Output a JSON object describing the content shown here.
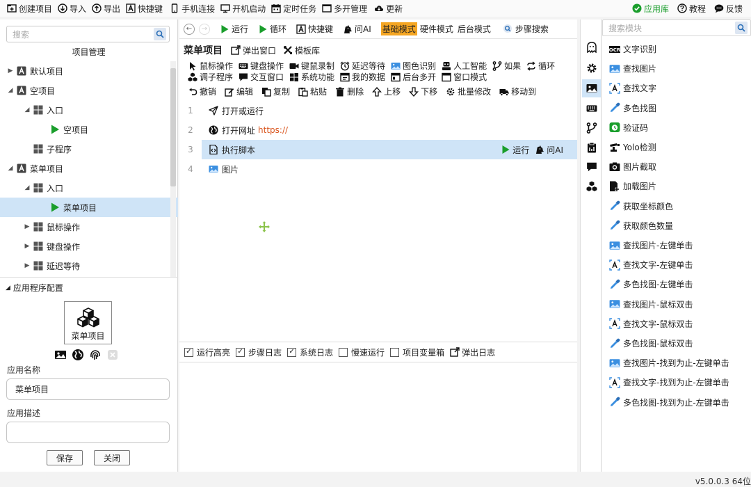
{
  "topbar": {
    "left": [
      {
        "label": "创建项目",
        "icon": "new-project-icon"
      },
      {
        "label": "导入",
        "icon": "import-icon"
      },
      {
        "label": "导出",
        "icon": "export-icon"
      },
      {
        "label": "快捷键",
        "icon": "hotkey-icon"
      },
      {
        "label": "手机连接",
        "icon": "phone-icon"
      },
      {
        "label": "开机启动",
        "icon": "boot-icon"
      },
      {
        "label": "定时任务",
        "icon": "calendar-icon"
      },
      {
        "label": "多开管理",
        "icon": "window-icon"
      },
      {
        "label": "更新",
        "icon": "cloud-icon"
      }
    ],
    "right": [
      {
        "label": "应用库",
        "icon": "check-circle-icon"
      },
      {
        "label": "教程",
        "icon": "help-icon"
      },
      {
        "label": "反馈",
        "icon": "chat-icon"
      }
    ]
  },
  "left": {
    "search_placeholder": "搜索",
    "title": "项目管理",
    "tree": [
      {
        "label": "默认项目",
        "level": 0,
        "arrow": "▶",
        "icon": "project"
      },
      {
        "label": "空项目",
        "level": 0,
        "arrow": "◢",
        "icon": "project"
      },
      {
        "label": "入口",
        "level": 1,
        "arrow": "◢",
        "icon": "grid"
      },
      {
        "label": "空项目",
        "level": 2,
        "arrow": "",
        "icon": "play"
      },
      {
        "label": "子程序",
        "level": 1,
        "arrow": "",
        "icon": "grid"
      },
      {
        "label": "菜单项目",
        "level": 0,
        "arrow": "◢",
        "icon": "project"
      },
      {
        "label": "入口",
        "level": 1,
        "arrow": "◢",
        "icon": "grid"
      },
      {
        "label": "菜单项目",
        "level": 2,
        "arrow": "",
        "icon": "play",
        "selected": true
      },
      {
        "label": "鼠标操作",
        "level": 1,
        "arrow": "▶",
        "icon": "grid"
      },
      {
        "label": "键盘操作",
        "level": 1,
        "arrow": "▶",
        "icon": "grid"
      },
      {
        "label": "延迟等待",
        "level": 1,
        "arrow": "▶",
        "icon": "grid"
      }
    ],
    "config_title": "应用程序配置",
    "app_icon_label": "菜单项目",
    "name_label": "应用名称",
    "name_value": "菜单项目",
    "desc_label": "应用描述",
    "desc_value": "",
    "save": "保存",
    "close": "关闭"
  },
  "center": {
    "toolbar": [
      {
        "label": "运行",
        "icon": "play-icon"
      },
      {
        "label": "循环",
        "icon": "play-icon"
      },
      {
        "label": "快捷键",
        "icon": "hotkey-icon"
      },
      {
        "label": "问AI",
        "icon": "ai-icon"
      }
    ],
    "modes": [
      "基础模式",
      "硬件模式",
      "后台模式"
    ],
    "step_search": "步骤搜索",
    "project_title": "菜单项目",
    "project_actions": [
      {
        "label": "弹出窗口",
        "icon": "popout-icon"
      },
      {
        "label": "模板库",
        "icon": "tools-icon"
      }
    ],
    "cats_row1": [
      {
        "label": "鼠标操作",
        "icon": "cursor-icon"
      },
      {
        "label": "键盘操作",
        "icon": "keyboard-icon"
      },
      {
        "label": "键鼠录制",
        "icon": "record-icon"
      },
      {
        "label": "延迟等待",
        "icon": "alarm-icon"
      },
      {
        "label": "图色识别",
        "icon": "image-icon"
      },
      {
        "label": "人工智能",
        "icon": "robot-icon"
      },
      {
        "label": "如果",
        "icon": "branch-icon"
      },
      {
        "label": "循环",
        "icon": "loop-icon"
      }
    ],
    "cats_row2": [
      {
        "label": "调子程序",
        "icon": "cubes-icon"
      },
      {
        "label": "交互窗口",
        "icon": "message-icon"
      },
      {
        "label": "系统功能",
        "icon": "windows-icon"
      },
      {
        "label": "我的数据",
        "icon": "data-icon"
      },
      {
        "label": "后台多开",
        "icon": "multiwin-icon"
      },
      {
        "label": "窗口模式",
        "icon": "window-mode-icon"
      }
    ],
    "edit": [
      {
        "label": "撤销",
        "icon": "undo-icon"
      },
      {
        "label": "编辑",
        "icon": "edit-icon"
      },
      {
        "label": "复制",
        "icon": "copy-icon"
      },
      {
        "label": "粘贴",
        "icon": "paste-icon"
      },
      {
        "label": "删除",
        "icon": "trash-icon"
      },
      {
        "label": "上移",
        "icon": "up-icon"
      },
      {
        "label": "下移",
        "icon": "down-icon"
      },
      {
        "label": "批量修改",
        "icon": "gear-icon"
      },
      {
        "label": "移动到",
        "icon": "truck-icon"
      }
    ],
    "steps": [
      {
        "num": "1",
        "label": "打开或运行",
        "url": "",
        "icon": "send-icon"
      },
      {
        "num": "2",
        "label": "打开网址",
        "url": "https://",
        "icon": "globe-icon"
      },
      {
        "num": "3",
        "label": "执行脚本",
        "url": "",
        "icon": "script-icon",
        "selected": true,
        "run": "运行",
        "ai": "问AI"
      },
      {
        "num": "4",
        "label": "图片",
        "url": "",
        "icon": "image-icon"
      }
    ],
    "log": [
      {
        "label": "运行高亮",
        "checked": true
      },
      {
        "label": "步骤日志",
        "checked": true
      },
      {
        "label": "系统日志",
        "checked": true
      },
      {
        "label": "慢速运行",
        "checked": false
      },
      {
        "label": "项目变量箱",
        "checked": false
      }
    ],
    "popout_log": "弹出日志"
  },
  "right": {
    "search_placeholder": "搜索模块",
    "modules": [
      {
        "label": "文字识别",
        "icon": "ocr-icon"
      },
      {
        "label": "查找图片",
        "icon": "image-icon"
      },
      {
        "label": "查找文字",
        "icon": "find-text-icon"
      },
      {
        "label": "多色找图",
        "icon": "dropper-icon"
      },
      {
        "label": "验证码",
        "icon": "alarm-icon"
      },
      {
        "label": "Yolo检测",
        "icon": "camera-icon"
      },
      {
        "label": "图片截取",
        "icon": "capture-icon"
      },
      {
        "label": "加载图片",
        "icon": "load-image-icon"
      },
      {
        "label": "获取坐标颜色",
        "icon": "dropper-icon"
      },
      {
        "label": "获取颜色数量",
        "icon": "dropper-icon"
      },
      {
        "label": "查找图片-左键单击",
        "icon": "image-icon"
      },
      {
        "label": "查找文字-左键单击",
        "icon": "find-text-icon"
      },
      {
        "label": "多色找图-左键单击",
        "icon": "dropper-icon"
      },
      {
        "label": "查找图片-鼠标双击",
        "icon": "image-icon"
      },
      {
        "label": "查找文字-鼠标双击",
        "icon": "find-text-icon"
      },
      {
        "label": "多色找图-鼠标双击",
        "icon": "dropper-icon"
      },
      {
        "label": "查找图片-找到为止-左键单击",
        "icon": "image-icon"
      },
      {
        "label": "查找文字-找到为止-左键单击",
        "icon": "find-text-icon"
      },
      {
        "label": "多色找图-找到为止-左键单击",
        "icon": "dropper-icon"
      }
    ]
  },
  "strip": [
    "ghost-icon",
    "settings-icon",
    "image-icon",
    "keyboard-icon",
    "branch-icon",
    "clipboard-icon",
    "message-icon",
    "cubes-icon"
  ],
  "version": "v5.0.0.3 64位",
  "colors": {
    "accent": "#1a9e2c",
    "blue": "#2b7de9",
    "selected": "#cfe4f7",
    "mode_active": "#f5a623",
    "url": "#d9541c"
  }
}
